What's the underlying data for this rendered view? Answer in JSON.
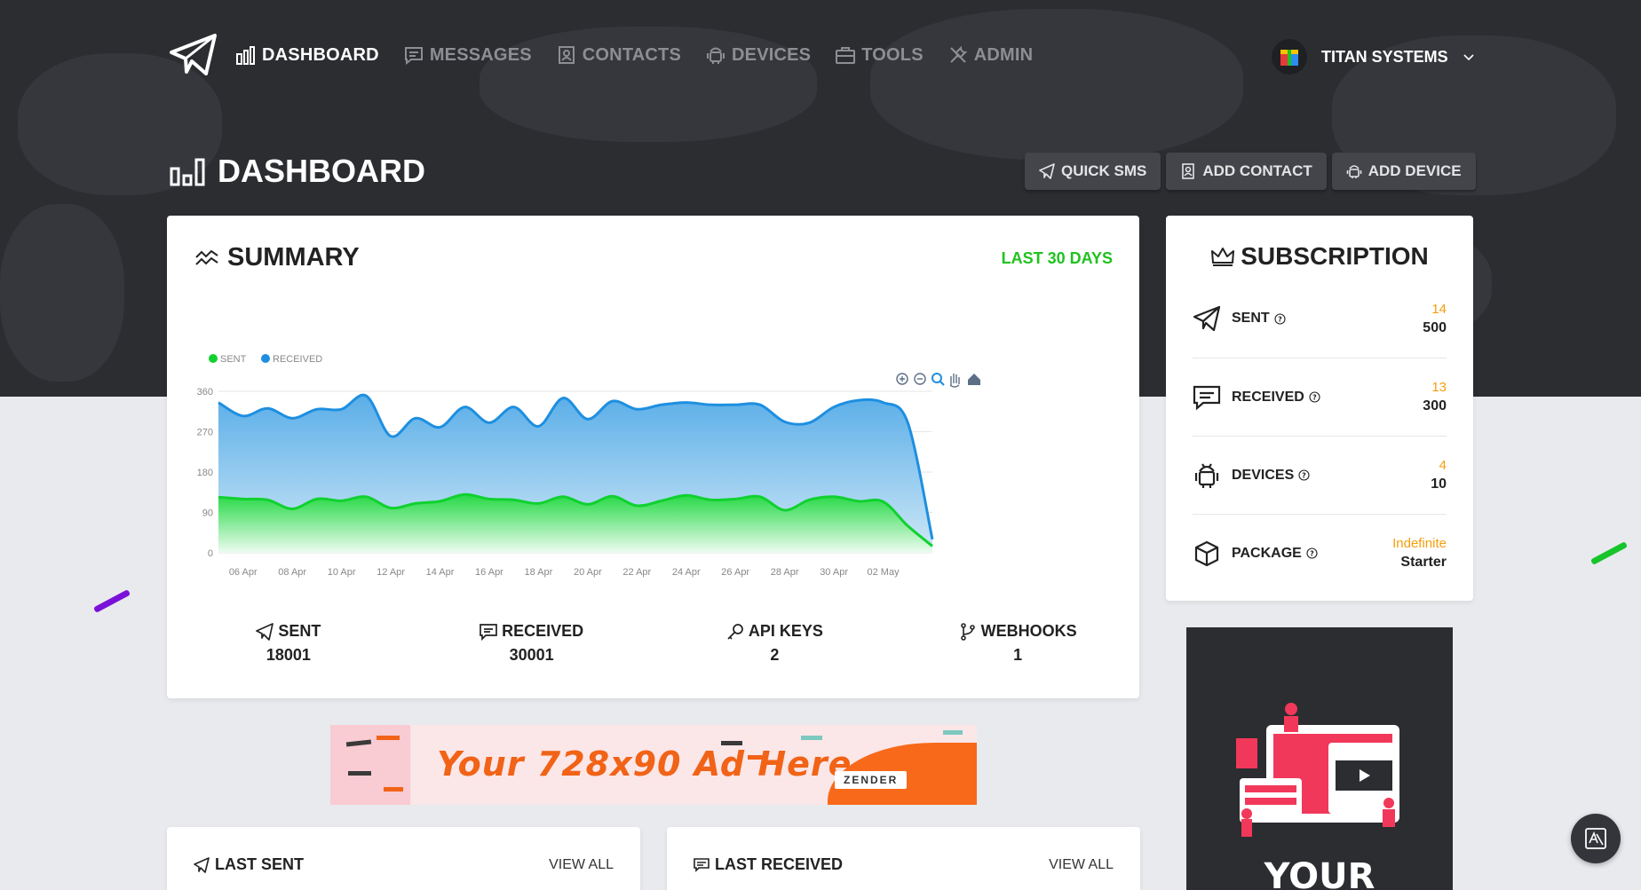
{
  "nav": {
    "items": [
      {
        "label": "DASHBOARD",
        "icon": "bar-chart-icon",
        "active": true
      },
      {
        "label": "MESSAGES",
        "icon": "message-icon"
      },
      {
        "label": "CONTACTS",
        "icon": "contact-icon"
      },
      {
        "label": "DEVICES",
        "icon": "android-icon"
      },
      {
        "label": "TOOLS",
        "icon": "toolbox-icon"
      },
      {
        "label": "ADMIN",
        "icon": "wrench-icon"
      }
    ],
    "user": "TITAN SYSTEMS"
  },
  "page": {
    "title": "DASHBOARD",
    "actions": [
      {
        "label": "QUICK SMS",
        "icon": "send-icon"
      },
      {
        "label": "ADD CONTACT",
        "icon": "contact-icon"
      },
      {
        "label": "ADD DEVICE",
        "icon": "android-icon"
      }
    ]
  },
  "summary": {
    "title": "SUMMARY",
    "period": "LAST 30 DAYS",
    "stats": [
      {
        "label": "SENT",
        "value": "18001",
        "icon": "send-icon"
      },
      {
        "label": "RECEIVED",
        "value": "30001",
        "icon": "message-icon"
      },
      {
        "label": "API KEYS",
        "value": "2",
        "icon": "key-icon"
      },
      {
        "label": "WEBHOOKS",
        "value": "1",
        "icon": "branch-icon"
      }
    ]
  },
  "chart_data": {
    "type": "area",
    "legend": "top-left",
    "ylim": [
      0,
      360
    ],
    "yticks": [
      "0",
      "90",
      "180",
      "270",
      "360"
    ],
    "xticks": [
      "06 Apr",
      "08 Apr",
      "10 Apr",
      "12 Apr",
      "14 Apr",
      "16 Apr",
      "18 Apr",
      "20 Apr",
      "22 Apr",
      "24 Apr",
      "26 Apr",
      "28 Apr",
      "30 Apr",
      "02 May"
    ],
    "x": [
      "05 Apr",
      "06 Apr",
      "07 Apr",
      "08 Apr",
      "09 Apr",
      "10 Apr",
      "11 Apr",
      "12 Apr",
      "13 Apr",
      "14 Apr",
      "15 Apr",
      "16 Apr",
      "17 Apr",
      "18 Apr",
      "19 Apr",
      "20 Apr",
      "21 Apr",
      "22 Apr",
      "23 Apr",
      "24 Apr",
      "25 Apr",
      "26 Apr",
      "27 Apr",
      "28 Apr",
      "29 Apr",
      "30 Apr",
      "01 May",
      "02 May",
      "03 May",
      "04 May"
    ],
    "series": [
      {
        "name": "SENT",
        "color": "#10d12f",
        "values": [
          124,
          120,
          118,
          98,
          120,
          116,
          125,
          100,
          110,
          115,
          130,
          120,
          118,
          110,
          125,
          108,
          126,
          105,
          116,
          128,
          118,
          120,
          125,
          95,
          118,
          125,
          115,
          114,
          60,
          15
        ]
      },
      {
        "name": "RECEIVED",
        "color": "#1e8fe0",
        "values": [
          335,
          305,
          322,
          300,
          320,
          320,
          350,
          260,
          300,
          280,
          325,
          290,
          325,
          282,
          345,
          298,
          338,
          320,
          330,
          335,
          330,
          330,
          330,
          292,
          290,
          325,
          340,
          335,
          290,
          30
        ]
      }
    ]
  },
  "chart_toolbar": [
    "zoom-in-icon",
    "zoom-out-icon",
    "magnifier-icon",
    "pan-hand-icon",
    "home-icon"
  ],
  "subscription": {
    "title": "SUBSCRIPTION",
    "rows": [
      {
        "label": "SENT",
        "used": "14",
        "limit": "500",
        "icon": "send-icon"
      },
      {
        "label": "RECEIVED",
        "used": "13",
        "limit": "300",
        "icon": "message-icon"
      },
      {
        "label": "DEVICES",
        "used": "4",
        "limit": "10",
        "icon": "android-icon"
      },
      {
        "label": "PACKAGE",
        "used": "Indefinite",
        "limit": "Starter",
        "icon": "box-icon"
      }
    ]
  },
  "ads": {
    "banner_text": "Your 728x90 Ad Here",
    "banner_brand": "ZENDER",
    "side_text": "YOUR"
  },
  "last_sent": {
    "title": "LAST SENT",
    "link": "VIEW ALL"
  },
  "last_received": {
    "title": "LAST RECEIVED",
    "link": "VIEW ALL"
  },
  "colors": {
    "accent_green": "#1ec31e",
    "warning": "#f59e0b",
    "hero_bg": "#2c2d31"
  }
}
